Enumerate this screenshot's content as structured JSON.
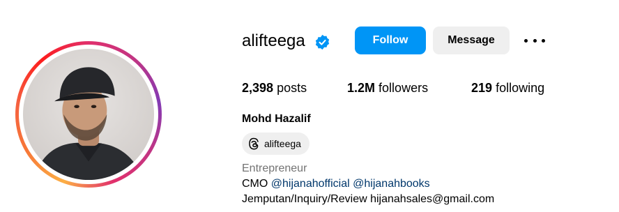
{
  "profile": {
    "username": "alifteega",
    "verified": true,
    "full_name": "Mohd Hazalif",
    "accent_color": "#0095f6"
  },
  "actions": {
    "follow_label": "Follow",
    "message_label": "Message",
    "more_icon": "ellipsis-icon"
  },
  "stats": {
    "posts_count": "2,398",
    "posts_label": "posts",
    "followers_count": "1.2M",
    "followers_label": "followers",
    "following_count": "219",
    "following_label": "following"
  },
  "threads_badge": {
    "icon": "threads-icon",
    "label": "alifteega"
  },
  "bio": {
    "category": "Entrepreneur",
    "line1_prefix": "CMO",
    "mention1": "@hijanahofficial",
    "mention2": "@hijanahbooks",
    "line2": "Jemputan/Inquiry/Review hijanahsales@gmail.com"
  }
}
